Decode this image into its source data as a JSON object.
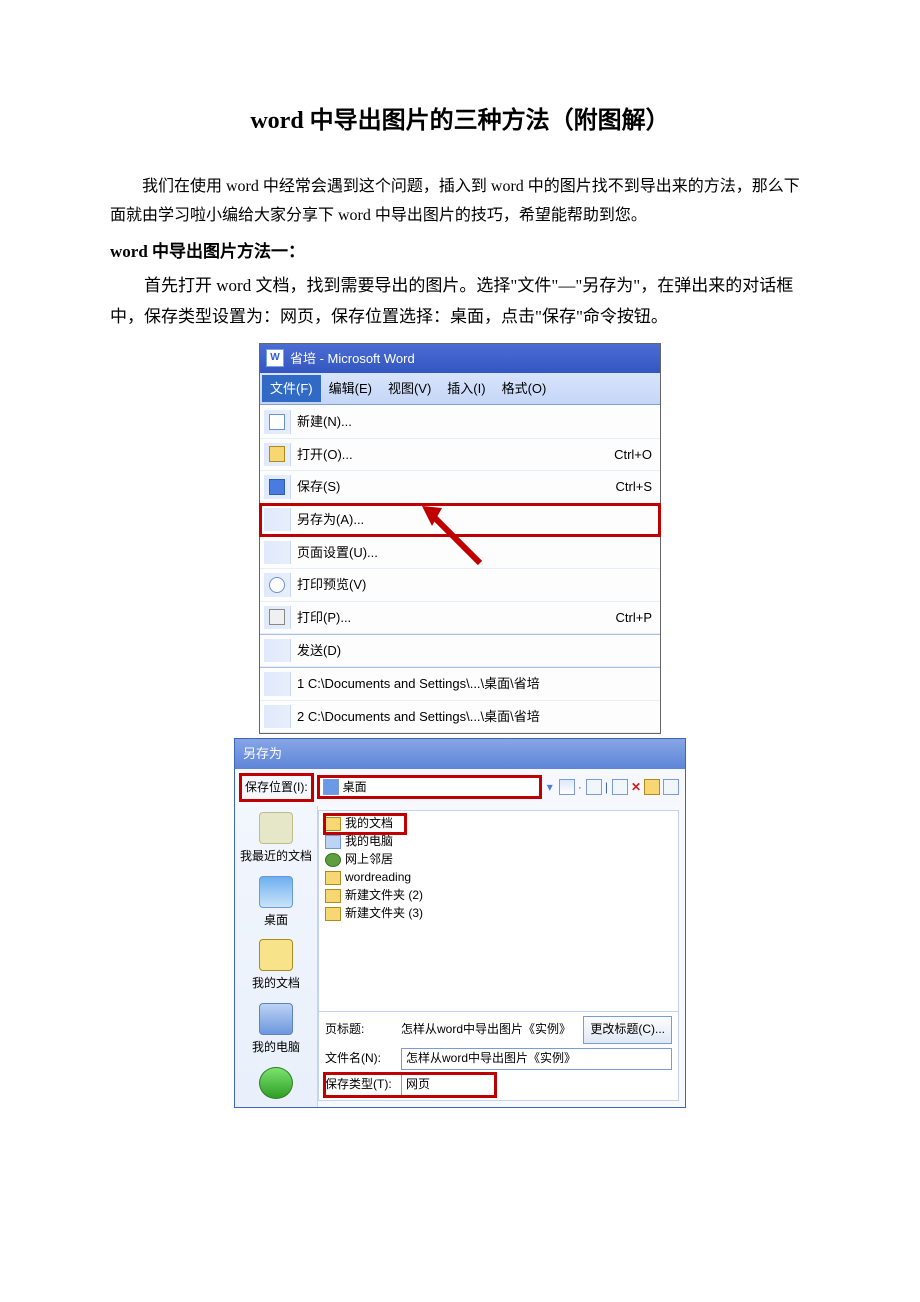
{
  "article": {
    "title": "word 中导出图片的三种方法（附图解）",
    "intro": "我们在使用 word 中经常会遇到这个问题，插入到 word 中的图片找不到导出来的方法，那么下面就由学习啦小编给大家分享下 word 中导出图片的技巧，希望能帮助到您。",
    "section1_head": "word 中导出图片方法一：",
    "section1_body": "首先打开 word 文档，找到需要导出的图片。选择\"文件\"—\"另存为\"，在弹出来的对话框中，保存类型设置为：网页，保存位置选择：桌面，点击\"保存\"命令按钮。"
  },
  "shot1": {
    "window_title": "省培 - Microsoft Word",
    "menubar": {
      "file": "文件(F)",
      "edit": "编辑(E)",
      "view": "视图(V)",
      "insert": "插入(I)",
      "format": "格式(O)"
    },
    "menu_items": {
      "new": "新建(N)...",
      "open": "打开(O)...",
      "open_sc": "Ctrl+O",
      "save": "保存(S)",
      "save_sc": "Ctrl+S",
      "save_as": "另存为(A)...",
      "page_setup": "页面设置(U)...",
      "print_preview": "打印预览(V)",
      "print": "打印(P)...",
      "print_sc": "Ctrl+P",
      "send": "发送(D)",
      "recent1": "1 C:\\Documents and Settings\\...\\桌面\\省培",
      "recent2": "2 C:\\Documents and Settings\\...\\桌面\\省培"
    }
  },
  "shot2": {
    "title": "另存为",
    "save_in_label": "保存位置(I):",
    "save_in_value": "桌面",
    "sidebar": {
      "recent": "我最近的文档",
      "desktop": "桌面",
      "docs": "我的文档",
      "pc": "我的电脑",
      "net": ""
    },
    "files": {
      "item0": "我的文档",
      "item1": "我的电脑",
      "item2": "网上邻居",
      "item3": "wordreading",
      "item4": "新建文件夹 (2)",
      "item5": "新建文件夹 (3)"
    },
    "page_title_label": "页标题:",
    "page_title_value": "怎样从word中导出图片《实例》",
    "change_title_btn": "更改标题(C)...",
    "filename_label": "文件名(N):",
    "filename_value": "怎样从word中导出图片《实例》",
    "filetype_label": "保存类型(T):",
    "filetype_value": "网页"
  }
}
